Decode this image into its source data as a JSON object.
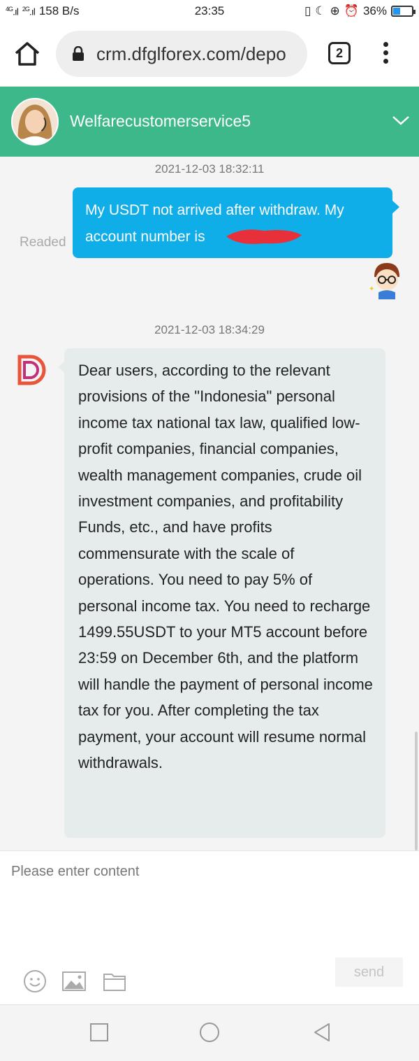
{
  "status_bar": {
    "network_left": "4G",
    "network_right": "2G",
    "speed": "158 B/s",
    "time": "23:35",
    "battery": "36%",
    "battery_level": 0.36
  },
  "browser": {
    "url": "crm.dfglforex.com/depo",
    "tab_count": "2"
  },
  "chat": {
    "agent_name": "Welfarecustomerservice5",
    "messages": [
      {
        "timestamp": "2021-12-03 18:32:11",
        "direction": "out",
        "text": "My USDT not arrived after withdraw. My account number is",
        "status": "Readed"
      },
      {
        "timestamp": "2021-12-03 18:34:29",
        "direction": "in",
        "text": "Dear users, according to the relevant provisions of the \"Indonesia\" personal income tax national tax law, qualified low-profit companies, financial companies, wealth management companies, crude oil investment companies, and profitability Funds, etc., and have profits commensurate with the scale of operations. You need to pay 5% of personal income tax. You need to recharge 1499.55USDT to your MT5 account before 23:59 on December 6th, and the platform will handle the payment of personal income tax for you. After completing the tax payment, your account will resume normal withdrawals."
      }
    ]
  },
  "composer": {
    "placeholder": "Please enter content",
    "send_label": "send"
  },
  "colors": {
    "header": "#3cb88b",
    "outgoing_bubble": "#0faee8",
    "incoming_bubble": "#e6ecec",
    "redaction": "#e8303a"
  }
}
